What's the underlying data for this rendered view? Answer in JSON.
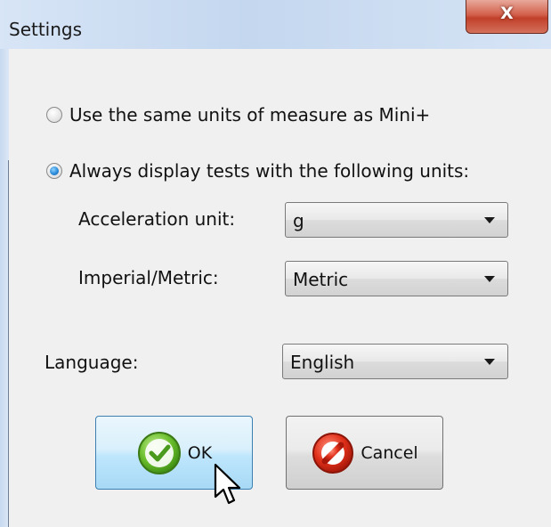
{
  "window": {
    "title": "Settings",
    "close_glyph": "X"
  },
  "units": {
    "option_same": {
      "label": "Use the same units of measure as Mini+",
      "checked": false
    },
    "option_always": {
      "label": "Always display tests with the following units:",
      "checked": true
    }
  },
  "acceleration": {
    "label": "Acceleration unit:",
    "value": "g"
  },
  "imperial_metric": {
    "label": "Imperial/Metric:",
    "value": "Metric"
  },
  "language": {
    "label": "Language:",
    "value": "English"
  },
  "buttons": {
    "ok": "OK",
    "cancel": "Cancel"
  },
  "colors": {
    "title_bar": "#c9dbf1",
    "close_red": "#c94a35",
    "ok_blue": "#bee6fd",
    "radio_blue": "#2a8ad8"
  },
  "icons": {
    "ok": "check-circle-icon",
    "cancel": "no-entry-icon",
    "cursor": "mouse-pointer-icon"
  }
}
